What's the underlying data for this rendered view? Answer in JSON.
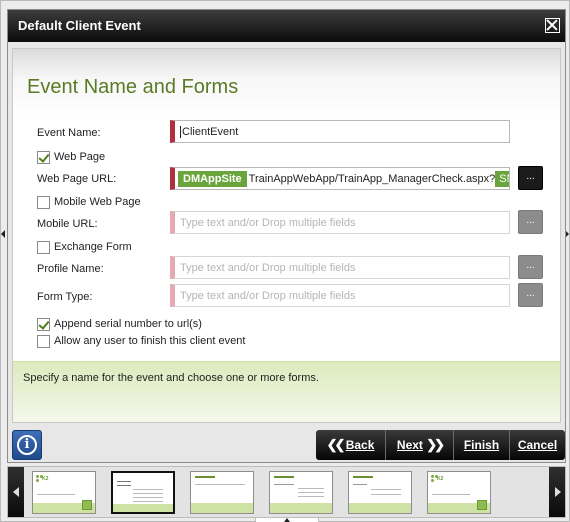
{
  "dialog": {
    "title": "Default Client Event"
  },
  "section": {
    "heading": "Event Name and Forms",
    "description": "Specify a name for the event and choose one or more forms."
  },
  "fields": {
    "event_name": {
      "label": "Event Name:",
      "value": "ClientEvent"
    },
    "web_page": {
      "label": "Web Page",
      "checked": true
    },
    "web_page_url": {
      "label": "Web Page URL:",
      "token": "DMAppSite",
      "text": "TrainAppWebApp/TrainApp_ManagerCheck.aspx?",
      "tail_token": "SN"
    },
    "mobile_web_page": {
      "label": "Mobile Web Page",
      "checked": false
    },
    "mobile_url": {
      "label": "Mobile URL:",
      "placeholder": "Type text and/or Drop multiple fields"
    },
    "exchange_form": {
      "label": "Exchange Form",
      "checked": false
    },
    "profile_name": {
      "label": "Profile Name:",
      "placeholder": "Type text and/or Drop multiple fields"
    },
    "form_type": {
      "label": "Form Type:",
      "placeholder": "Type text and/or Drop multiple fields"
    },
    "append_serial": {
      "label": "Append serial number to url(s)",
      "checked": true
    },
    "allow_any_user": {
      "label": "Allow any user to finish this client event",
      "checked": false
    }
  },
  "browse_button_label": "...",
  "buttons": {
    "back": "Back",
    "next": "Next",
    "finish": "Finish",
    "cancel": "Cancel",
    "info_icon_glyph": "i"
  },
  "thumbnail_brand": "K2",
  "colors": {
    "accent_green": "#5a7a26",
    "required_marker": "#b03040",
    "token_green": "#6aa43c"
  }
}
